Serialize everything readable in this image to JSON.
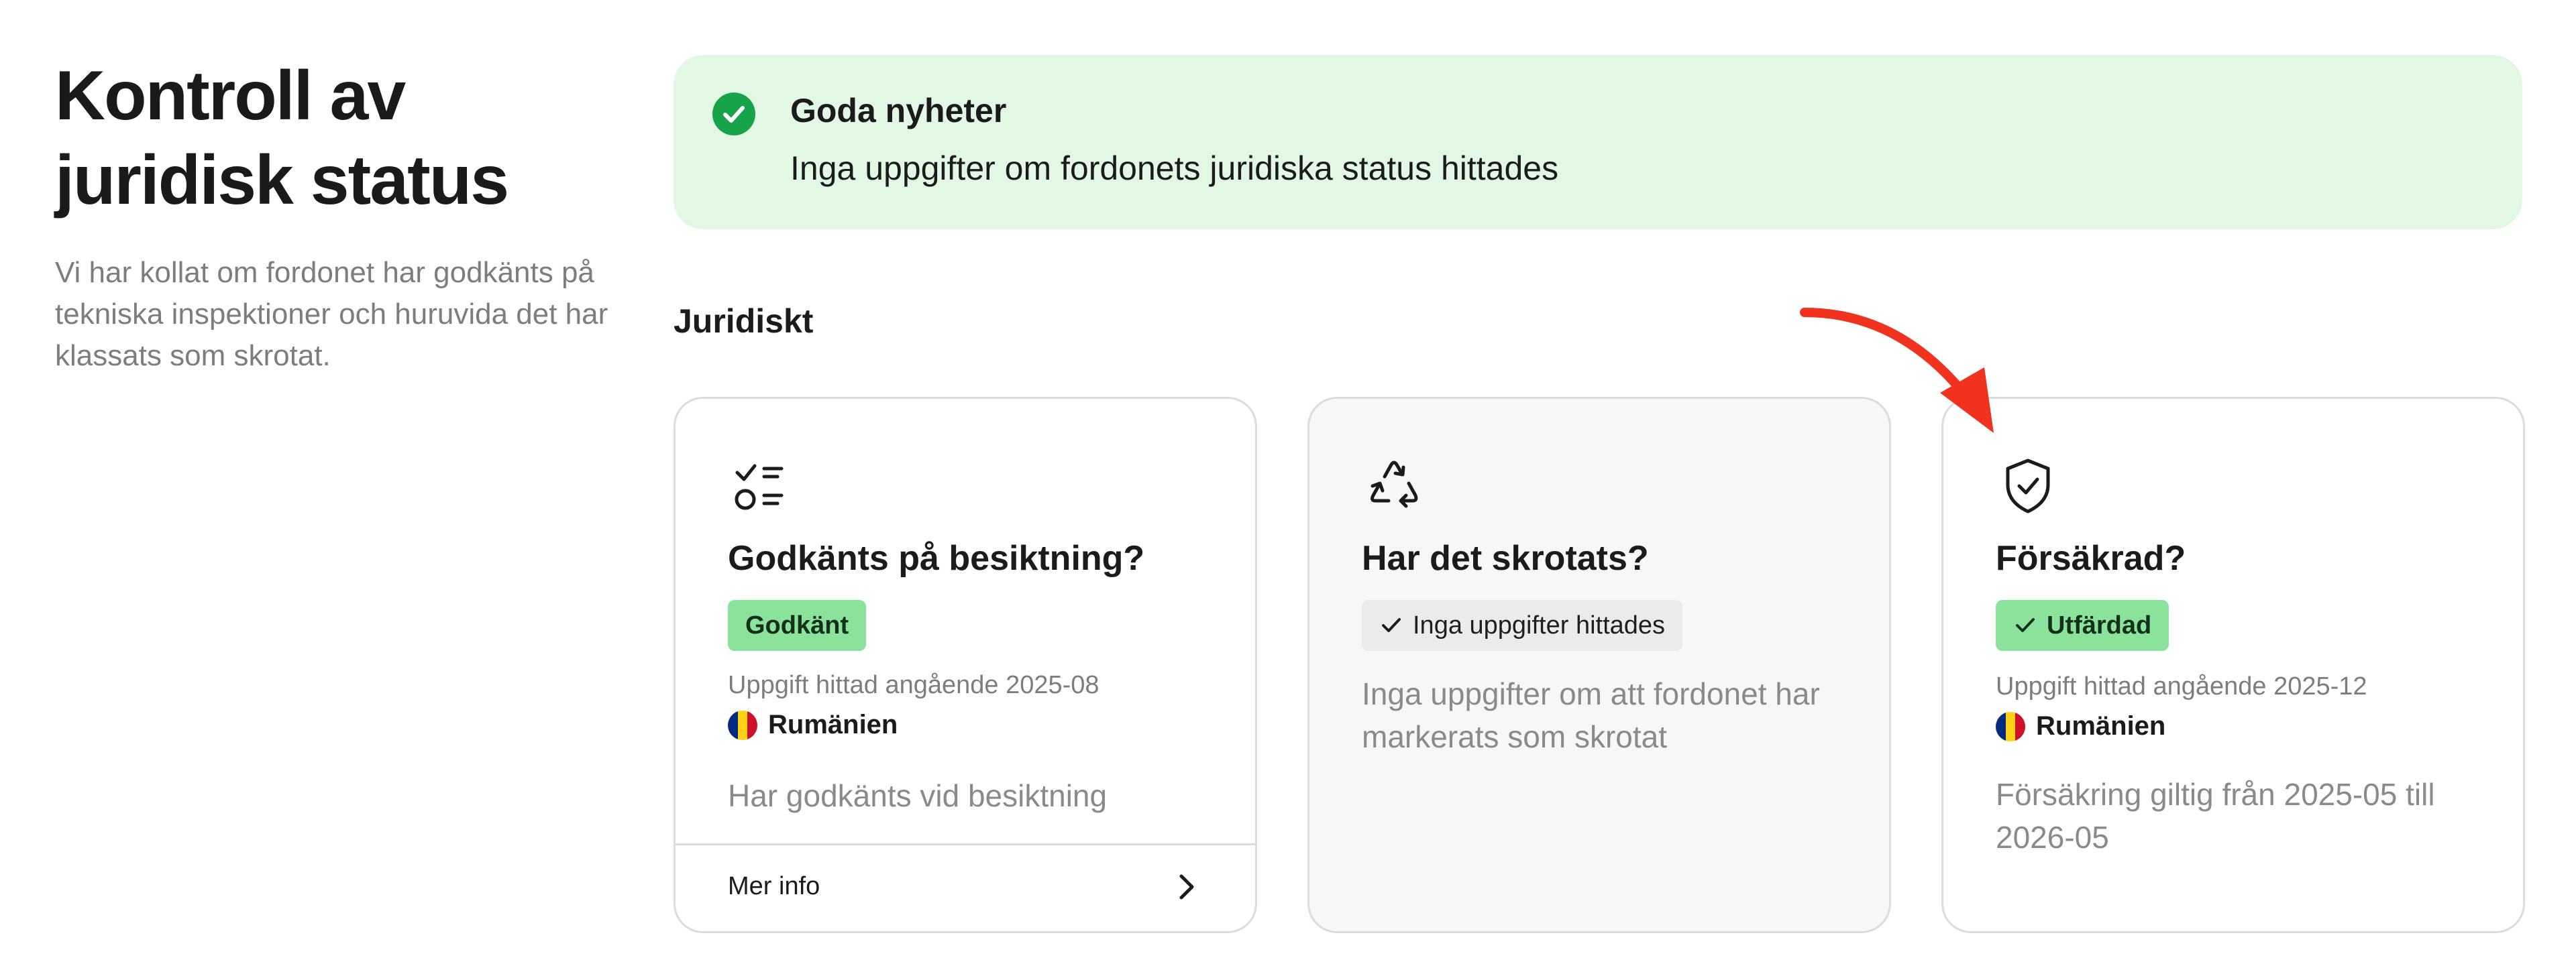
{
  "intro": {
    "title_line1": "Kontroll av",
    "title_line2": "juridisk status",
    "description": "Vi har kollat om fordonet har godkänts på tekniska inspektioner och huruvida det har klassats som skrotat."
  },
  "banner": {
    "icon": "check-circle-icon",
    "title": "Goda nyheter",
    "text": "Inga uppgifter om fordonets juridiska status hittades",
    "background": "#e3f8e4",
    "accent": "#17a34a"
  },
  "section": {
    "title": "Juridiskt"
  },
  "cards": [
    {
      "icon": "checklist-icon",
      "title": "Godkänts på besiktning?",
      "badge": "Godkänt",
      "found": "Uppgift hittad angående 2025-08",
      "country": "Rumänien",
      "body": "Har godkänts vid besiktning",
      "footer_label": "Mer info"
    },
    {
      "icon": "recycle-icon",
      "title": "Har det skrotats?",
      "badge": "Inga uppgifter hittades",
      "body": "Inga uppgifter om att fordonet har markerats som skrotat"
    },
    {
      "icon": "shield-check-icon",
      "title": "Försäkrad?",
      "badge": "Utfärdad",
      "found": "Uppgift hittad angående 2025-12",
      "country": "Rumänien",
      "body": "Försäkring giltig från 2025-05 till 2026-05"
    }
  ],
  "colors": {
    "badge_green": "#8be39b",
    "badge_neutral": "#ebebeb",
    "annotation_arrow": "#f0321e",
    "flag_romania": [
      "#002b7f",
      "#fcd116",
      "#ce1126"
    ]
  }
}
